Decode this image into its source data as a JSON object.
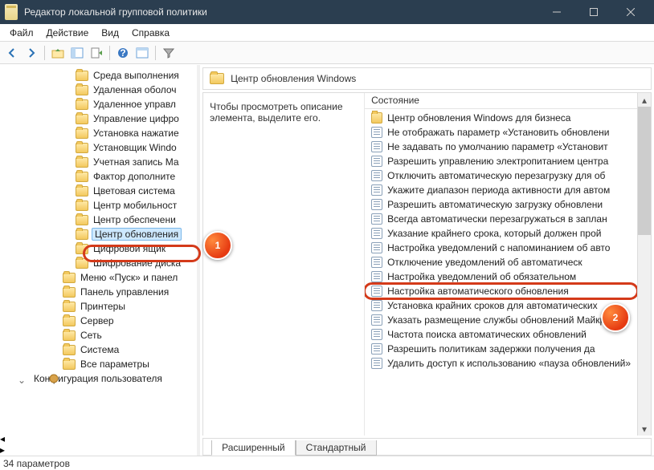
{
  "window": {
    "title": "Редактор локальной групповой политики"
  },
  "menu": {
    "file": "Файл",
    "action": "Действие",
    "view": "Вид",
    "help": "Справка"
  },
  "tree": {
    "items": [
      "Среда выполнения",
      "Удаленная оболоч",
      "Удаленное управл",
      "Управление цифро",
      "Установка нажатие",
      "Установщик Windo",
      "Учетная запись Ма",
      "Фактор дополните",
      "Цветовая система",
      "Центр мобильност",
      "Центр обеспечени",
      "Центр обновления",
      "Цифровой ящик",
      "Шифрование диска",
      "Меню «Пуск» и панел",
      "Панель управления",
      "Принтеры",
      "Сервер",
      "Сеть",
      "Система",
      "Все параметры"
    ],
    "user_config": "Конфигурация пользователя"
  },
  "right": {
    "header": "Центр обновления Windows",
    "description": "Чтобы просмотреть описание элемента, выделите его.",
    "column": "Состояние",
    "policies": [
      {
        "t": "folder",
        "label": "Центр обновления Windows для бизнеса"
      },
      {
        "t": "pol",
        "label": "Не отображать параметр «Установить обновлени"
      },
      {
        "t": "pol",
        "label": "Не задавать по умолчанию параметр «Установит"
      },
      {
        "t": "pol",
        "label": "Разрешить управлению электропитанием центра"
      },
      {
        "t": "pol",
        "label": "Отключить автоматическую перезагрузку для об"
      },
      {
        "t": "pol",
        "label": "Укажите диапазон периода активности для автом"
      },
      {
        "t": "pol",
        "label": "Разрешить автоматическую загрузку обновлени"
      },
      {
        "t": "pol",
        "label": "Всегда автоматически перезагружаться в заплан"
      },
      {
        "t": "pol",
        "label": "Указание крайнего срока, который должен прой"
      },
      {
        "t": "pol",
        "label": "Настройка уведомлений с напоминанием об авто"
      },
      {
        "t": "pol",
        "label": "Отключение уведомлений об автоматическ"
      },
      {
        "t": "pol",
        "label": "Настройка уведомлений об обязательном"
      },
      {
        "t": "pol",
        "label": "Настройка автоматического обновления",
        "hl": true
      },
      {
        "t": "pol",
        "label": "Установка крайних сроков для автоматических"
      },
      {
        "t": "pol",
        "label": "Указать размещение службы обновлений Майкр"
      },
      {
        "t": "pol",
        "label": "Частота поиска автоматических обновлений"
      },
      {
        "t": "pol",
        "label": "Разрешить политикам задержки получения да"
      },
      {
        "t": "pol",
        "label": "Удалить доступ к использованию «пауза обновлений»"
      }
    ],
    "tabs": {
      "extended": "Расширенный",
      "standard": "Стандартный"
    }
  },
  "status": "34 параметров",
  "callouts": {
    "one": "1",
    "two": "2"
  }
}
